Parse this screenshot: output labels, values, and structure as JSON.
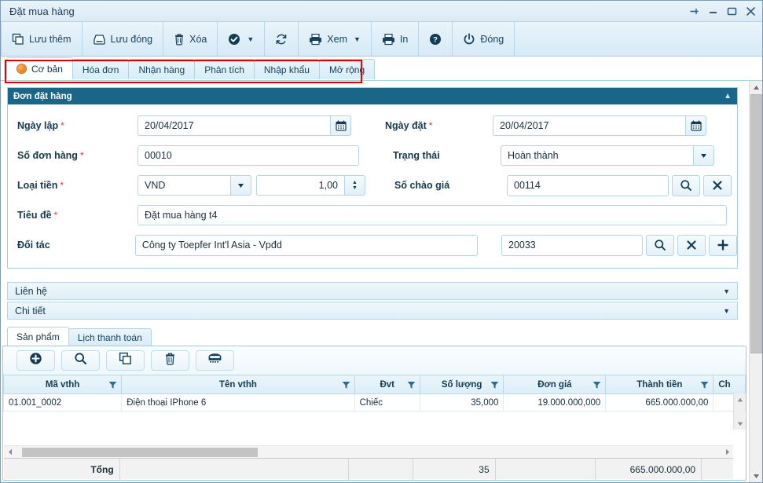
{
  "window": {
    "title": "Đặt mua hàng",
    "controls": [
      "pin-icon",
      "minimize-icon",
      "maximize-icon",
      "close-icon"
    ]
  },
  "toolbar": {
    "buttons": [
      {
        "label": "Lưu thêm",
        "icon": "copy-icon",
        "caret": false
      },
      {
        "label": "Lưu đóng",
        "icon": "save-icon",
        "caret": false
      },
      {
        "label": "Xóa",
        "icon": "trash-icon",
        "caret": false
      },
      {
        "label": "",
        "icon": "check-circle-icon",
        "caret": true
      },
      {
        "label": "",
        "icon": "refresh-icon",
        "caret": false
      },
      {
        "label": "Xem",
        "icon": "printer-icon",
        "caret": true
      },
      {
        "label": "In",
        "icon": "printer-icon",
        "caret": false
      },
      {
        "label": "",
        "icon": "help-icon",
        "caret": false
      },
      {
        "label": "Đóng",
        "icon": "power-icon",
        "caret": false
      }
    ]
  },
  "tabs": {
    "items": [
      {
        "label": "Cơ bản",
        "active": true,
        "bullet": true
      },
      {
        "label": "Hóa đơn",
        "active": false,
        "bullet": false
      },
      {
        "label": "Nhận hàng",
        "active": false,
        "bullet": false
      },
      {
        "label": "Phân tích",
        "active": false,
        "bullet": false
      },
      {
        "label": "Nhập khẩu",
        "active": false,
        "bullet": false
      },
      {
        "label": "Mở rộng",
        "active": false,
        "bullet": false
      }
    ],
    "highlight_color": "#e00000"
  },
  "panel": {
    "title": "Đơn đặt hàng",
    "collapse_icon": "chevron-up-icon",
    "fields": {
      "ngay_lap": {
        "label": "Ngày lập",
        "required": true,
        "value": "20/04/2017",
        "icon": "calendar-icon"
      },
      "ngay_dat": {
        "label": "Ngày đặt",
        "required": true,
        "value": "20/04/2017",
        "icon": "calendar-icon"
      },
      "so_don_hang": {
        "label": "Số đơn hàng",
        "required": true,
        "value": "00010"
      },
      "trang_thai": {
        "label": "Trạng thái",
        "required": false,
        "value": "Hoàn thành",
        "icon": "chevron-down-icon"
      },
      "loai_tien": {
        "label": "Loại tiền",
        "required": true,
        "value": "VND",
        "rate": "1,00",
        "icon": "chevron-down-icon"
      },
      "so_chao_gia": {
        "label": "Số chào giá",
        "required": false,
        "value": "00114"
      },
      "tieu_de": {
        "label": "Tiêu đề",
        "required": true,
        "value": "Đặt mua hàng t4"
      },
      "doi_tac": {
        "label": "Đối tác",
        "required": false,
        "value": "Công ty Toepfer Int'l Asia - Vpđd",
        "code": "20033"
      }
    }
  },
  "sections": [
    {
      "label": "Liên hệ",
      "icon": "chevron-down-icon"
    },
    {
      "label": "Chi tiết",
      "icon": "chevron-down-icon"
    }
  ],
  "bottom_tabs": {
    "items": [
      {
        "label": "Sản phẩm",
        "active": true
      },
      {
        "label": "Lịch thanh toán",
        "active": false
      }
    ]
  },
  "grid_toolbar": {
    "buttons": [
      {
        "icon": "add-circle-icon"
      },
      {
        "icon": "search-icon"
      },
      {
        "icon": "copy-icon"
      },
      {
        "icon": "trash-icon"
      },
      {
        "icon": "calculator-icon"
      }
    ]
  },
  "grid": {
    "columns": [
      {
        "label": "Mã vthh",
        "align": "left",
        "filter": true
      },
      {
        "label": "Tên vthh",
        "align": "left",
        "filter": true
      },
      {
        "label": "Đvt",
        "align": "left",
        "filter": true
      },
      {
        "label": "Số lượng",
        "align": "right",
        "filter": true
      },
      {
        "label": "Đơn giá",
        "align": "right",
        "filter": true
      },
      {
        "label": "Thành tiền",
        "align": "right",
        "filter": true
      },
      {
        "label": "Ch",
        "align": "left",
        "filter": false
      }
    ],
    "rows": [
      {
        "ma_vthh": "01.001_0002",
        "ten_vthh": "Điện thoại IPhone 6",
        "dvt": "Chiếc",
        "so_luong": "35,000",
        "don_gia": "19.000.000,000",
        "thanh_tien": "665.000.000,00",
        "ch": ""
      }
    ],
    "total": {
      "label": "Tổng",
      "so_luong": "35",
      "thanh_tien": "665.000.000,00"
    }
  }
}
